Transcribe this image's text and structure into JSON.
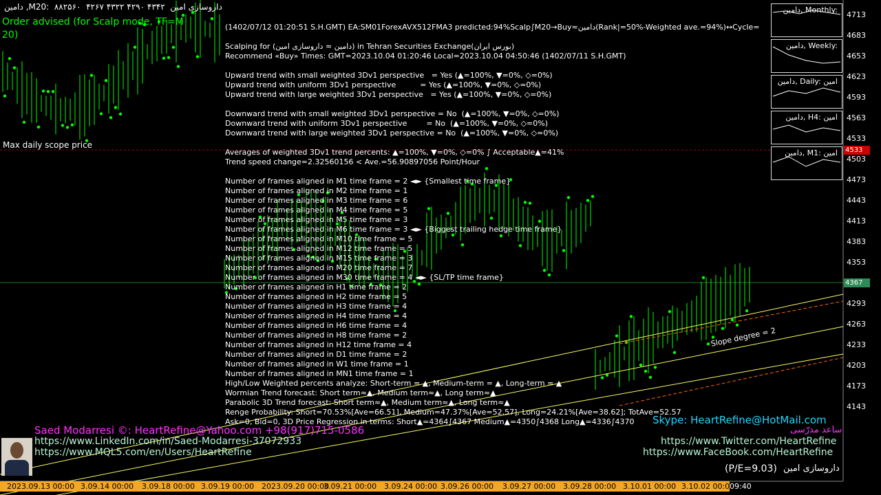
{
  "header": {
    "symbol_line": "دامین ,M20:  ۸۸۲۵۶۰  ۴۲۶۷ ۴۳۲۲ ۴۲۹۰ ۴۳۴۲  داروسازی امین",
    "order_line1": "Order advised (for Scalp mode, TF=M",
    "order_line2": "20)",
    "max_daily": "Max daily scope price"
  },
  "info_lines": [
    "(1402/07/12 01:20:51 S.H.GMT) EA:SM01ForexAVX512FMA3 predicted:94%Scalp∫M20→Buy≈دامین(Rank|=50%-Weighted ave.=94%)↔Cycle=",
    "",
    "Scalping for (دامین ≈ داروسازی امین) in Tehran Securities Exchange(بورس ایران)",
    "Recommend «Buy» Times: GMT=2023.10.04 01:20:46 Local=2023.10.04 04:50:46 (1402/07/11 S.H.GMT)",
    "",
    "Upward trend with small weighted 3Dv1 perspective   = Yes (▲=100%, ▼=0%, ◇=0%)",
    "Upward trend with uniform 3Dv1 perspective          = Yes (▲=100%, ▼=0%, ◇=0%)",
    "Upward trend with large weighted 3Dv1 perspective   = Yes (▲=100%, ▼=0%, ◇=0%)",
    "",
    "Downward trend with small weighted 3Dv1 perspective = No  (▲=100%, ▼=0%, ◇=0%)",
    "Downward trend with uniform 3Dv1 perspective        = No  (▲=100%, ▼=0%, ◇=0%)",
    "Downward trend with large weighted 3Dv1 perspective = No  (▲=100%, ▼=0%, ◇=0%)",
    "",
    "Averages of weighted 3Dv1 trend percents: ▲=100%, ▼=0%, ◇=0% ∫ Acceptable▲=41%",
    "Trend speed change=2.32560156 < Ave.=56.90897056 Point/Hour",
    "",
    "Number of frames aligned in M1 time frame = 2 ◄► {Smallest time frame}",
    "Number of frames aligned in M2 time frame = 1",
    "Number of frames aligned in M3 time frame = 6",
    "Number of frames aligned in M4 time frame = 5",
    "Number of frames aligned in M5 time frame = 3",
    "Number of frames aligned in M6 time frame = 3 ◄► {Biggest trailing hedge time frame}",
    "Number of frames aligned in M10 time frame = 5",
    "Number of frames aligned in M12 time frame = 5",
    "Number of frames aligned in M15 time frame = 3",
    "Number of frames aligned in M20 time frame = 7",
    "Number of frames aligned in M30 time frame = 4 ◄► {SL/TP time frame}",
    "Number of frames aligned in H1 time frame = 2",
    "Number of frames aligned in H2 time frame = 5",
    "Number of frames aligned in H3 time frame = 4",
    "Number of frames aligned in H4 time frame = 4",
    "Number of frames aligned in H6 time frame = 4",
    "Number of frames aligned in H8 time frame = 2",
    "Number of frames aligned in H12 time frame = 4",
    "Number of frames aligned in D1 time frame = 2",
    "Number of frames aligned in W1 time frame = 1",
    "Number of frames aligned in MN1 time frame = 1",
    "High/Low Weighted percents analyze: Short-term = ▲, Medium-term = ▲, Long-term = ▲",
    "Wormian Trend forecast: Short term≈▲, Medium term≈▲, Long term≈▲",
    "Parabolic 3D Trend forecast: Short term≈▲, Medium term≈▲, Long term≈▲",
    "Renge Probability: Short=70.53%[Ave=66.51], Medium=47.37%[Ave=52.57], Long=24.21%[Ave=38.62]; TotAve=52.57",
    "Ask=0, Bid=0, 3D Price Regression in terms: Short▲=4364∫4367 Medium▲=4350∫4368 Long▲=4336∫4370"
  ],
  "price_axis": [
    "4713",
    "4683",
    "4653",
    "4623",
    "4593",
    "4563",
    "4533",
    "4503",
    "4473",
    "4443",
    "4413",
    "4383",
    "4353",
    "4323",
    "4293",
    "4263",
    "4233",
    "4203",
    "4173",
    "4143"
  ],
  "price_tags": {
    "current": "4367",
    "red": "4533"
  },
  "date_axis": [
    "2023.09.13 00:00",
    "3.09.14 00:00",
    "3.09.18 00:00",
    "3.09.19 00:00",
    "2023.09.20 00:00",
    "3.09.21 00:00",
    "3.09.24 00:00",
    "3.09.26 00:00",
    "3.09.27 00:00",
    "3.09.28 00:00",
    "3.10.01 00:00",
    "3.10.02 00:00",
    "09:40"
  ],
  "mini_charts": [
    "دامین, Monthly:",
    "دامین, Weekly:",
    "دامین, Daily: امین",
    "دامین, H4: امین",
    "دامین, M1: امین"
  ],
  "slope_label": "Slope degree = 2",
  "footer": {
    "author": "Saed Modarresi ©: HeartRefine@Yahoo.com +98(917)715-0586",
    "skype": "Skype: HeartRefine@HotMail.com",
    "farsi_name": "ساعد مدرّسی",
    "linkedin": "https://www.LinkedIn.com/in/Saed-Modarresi-37072933",
    "mql5": "https://www.MQL5.com/en/Users/HeartRefine",
    "twitter": "https://www.Twitter.com/HeartRefine",
    "facebook": "https://www.FaceBook.com/HeartRefine",
    "pe": "(P/E=9.03)",
    "company": "داروسازی امین"
  },
  "colors": {
    "bars": "#00ff00",
    "trend_line": "#ffff66",
    "dashed": "#ff6600",
    "current_line": "#00c000",
    "red_line": "#ff0000"
  }
}
